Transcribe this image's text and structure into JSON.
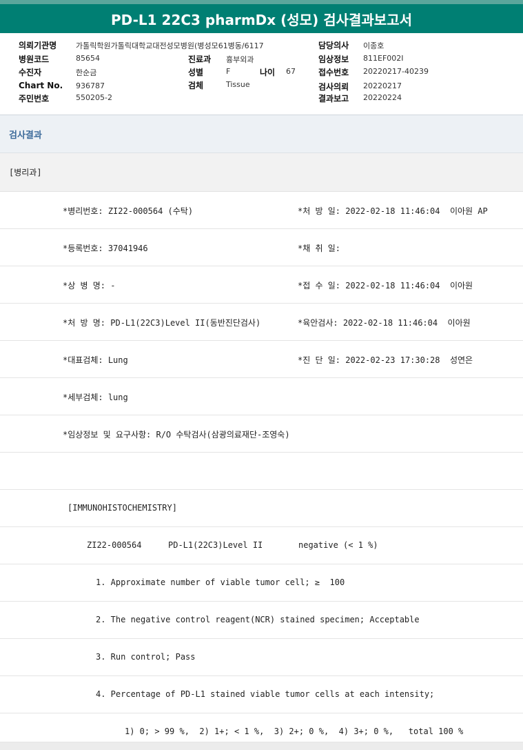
{
  "title": "PD-L1 22C3 pharmDx (성모) 검사결과보고서",
  "header": {
    "institution_label": "의뢰기관명",
    "institution_value": "가톨릭학원가톨릭대학교대전성모병원(병성모61병동/6117",
    "doctor_label": "담당의사",
    "doctor_value": "이종호",
    "hospital_code_label": "병원코드",
    "hospital_code_value": "85654",
    "dept_label": "진료과",
    "dept_value": "흉부외과",
    "clinical_label": "임상정보",
    "clinical_value": "811EF002I",
    "patient_label": "수진자",
    "patient_value": "한순금",
    "sex_label": "성별",
    "sex_value": "F",
    "age_label": "나이",
    "age_value": "67",
    "receipt_no_label": "접수번호",
    "receipt_no_value": "20220217-40239",
    "chart_label": "Chart No.",
    "chart_value": "936787",
    "specimen_label": "검체",
    "specimen_value": "Tissue",
    "request_label": "검사의뢰",
    "request_value": "20220217",
    "resident_label": "주민번호",
    "resident_value": "550205-2",
    "report_label": "결과보고",
    "report_value": "20220224"
  },
  "section_title": "검사결과",
  "department": "[병리과]",
  "rows": [
    {
      "left": "*병리번호: ZI22-000564 (수탁)",
      "right": "*처 방 일: 2022-02-18 11:46:04  이아원 AP"
    },
    {
      "left": "*등록번호: 37041946",
      "right": "*채 취 일:"
    },
    {
      "left": "*상 병 명: -",
      "right": "*접 수 일: 2022-02-18 11:46:04  이아원"
    },
    {
      "left": "*처 방 명: PD-L1(22C3)Level II(동반진단검사)",
      "right": "*육안검사: 2022-02-18 11:46:04  이아원"
    },
    {
      "left": "*대표검체: Lung",
      "right": "*진 단 일: 2022-02-23 17:30:28  성연은"
    },
    {
      "left": "*세부검체: lung",
      "right": ""
    },
    {
      "left": "*임상정보 및 요구사항: R/O 수탁검사(삼광의료재단-조영숙)",
      "right": ""
    }
  ],
  "ihc_header": "[IMMUNOHISTOCHEMISTRY]",
  "ihc_summary": {
    "specimen": "ZI22-000564",
    "test": "PD-L1(22C3)Level II",
    "result": "negative (< 1 %)"
  },
  "findings": [
    "1. Approximate number of viable tumor cell; ≥  100",
    "2. The negative control reagent(NCR) stained specimen; Acceptable",
    "3. Run control; Pass",
    "4. Percentage of PD-L1 stained viable tumor cells at each intensity;"
  ],
  "intensity_line": "1) 0; > 99 %,  2) 1+; < 1 %,  3) 2+; 0 %,  4) 3+; 0 %,   total 100 %"
}
